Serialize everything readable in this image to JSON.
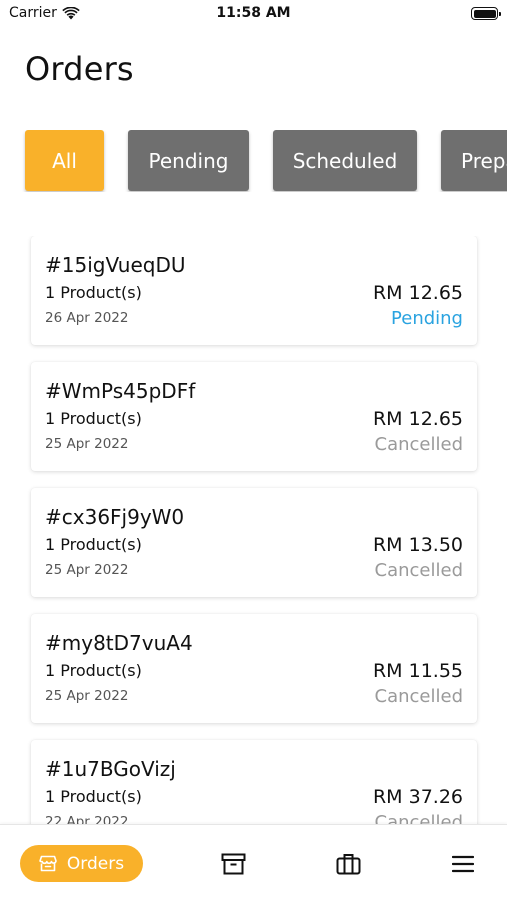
{
  "status_bar": {
    "carrier": "Carrier",
    "time": "11:58 AM"
  },
  "page_title": "Orders",
  "filters": [
    {
      "label": "All",
      "active": true
    },
    {
      "label": "Pending",
      "active": false
    },
    {
      "label": "Scheduled",
      "active": false
    },
    {
      "label": "Preparing",
      "active": false
    }
  ],
  "orders": [
    {
      "id": "#15igVueqDU",
      "products": "1 Product(s)",
      "date": "26 Apr 2022",
      "price": "RM 12.65",
      "status": "Pending"
    },
    {
      "id": "#WmPs45pDFf",
      "products": "1 Product(s)",
      "date": "25 Apr 2022",
      "price": "RM 12.65",
      "status": "Cancelled"
    },
    {
      "id": "#cx36Fj9yW0",
      "products": "1 Product(s)",
      "date": "25 Apr 2022",
      "price": "RM 13.50",
      "status": "Cancelled"
    },
    {
      "id": "#my8tD7vuA4",
      "products": "1 Product(s)",
      "date": "25 Apr 2022",
      "price": "RM 11.55",
      "status": "Cancelled"
    },
    {
      "id": "#1u7BGoVizj",
      "products": "1 Product(s)",
      "date": "22 Apr 2022",
      "price": "RM 37.26",
      "status": "Cancelled"
    }
  ],
  "bottom_nav": {
    "orders_label": "Orders",
    "icons": [
      "store-icon",
      "archive-box-icon",
      "briefcase-icon",
      "hamburger-menu-icon"
    ]
  },
  "colors": {
    "accent": "#f9b12a",
    "chip_inactive": "#6f6f6f",
    "pending": "#2aa3e0",
    "cancelled": "#9a9a9a"
  }
}
